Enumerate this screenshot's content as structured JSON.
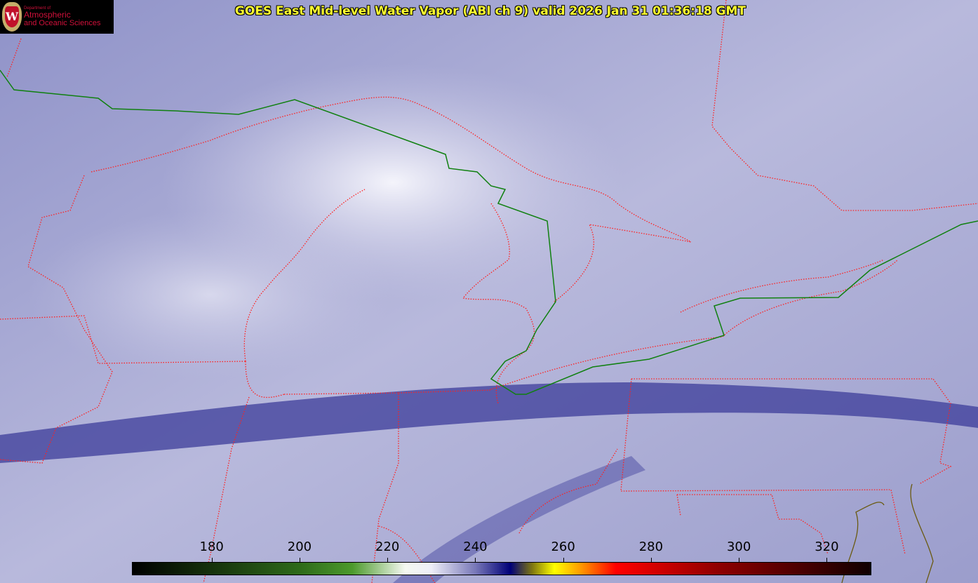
{
  "title": "GOES East Mid-level Water Vapor (ABI ch 9)  valid 2026 Jan 31 01:36:18 GMT",
  "logo": {
    "line1": "Department of",
    "line2": "Atmospheric",
    "line3": "and Oceanic Sciences",
    "emblem": "W"
  },
  "colorbar": {
    "range": [
      162,
      330
    ],
    "ticks": [
      180,
      200,
      220,
      240,
      260,
      280,
      300,
      320
    ],
    "stops": [
      {
        "v": 162,
        "c": "#000000"
      },
      {
        "v": 200,
        "c": "#2e6a1a"
      },
      {
        "v": 212,
        "c": "#4c9a2c"
      },
      {
        "v": 224,
        "c": "#f4f8f0"
      },
      {
        "v": 230,
        "c": "#eeeef8"
      },
      {
        "v": 240,
        "c": "#7878b8"
      },
      {
        "v": 248,
        "c": "#000078"
      },
      {
        "v": 253,
        "c": "#807810"
      },
      {
        "v": 258,
        "c": "#ffff00"
      },
      {
        "v": 264,
        "c": "#ff9a00"
      },
      {
        "v": 272,
        "c": "#ff0000"
      },
      {
        "v": 295,
        "c": "#900000"
      },
      {
        "v": 330,
        "c": "#100000"
      }
    ]
  },
  "colors": {
    "state_borders": "#ff2020",
    "intl_border": "#008000",
    "coast": "#6a5a10"
  }
}
